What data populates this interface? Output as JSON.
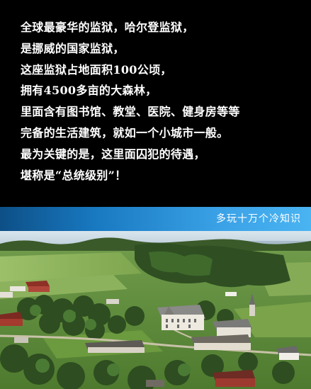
{
  "article": {
    "lines": [
      "全球最豪华的监狱，哈尔登监狱，",
      "是挪威的国家监狱，",
      "这座监狱占地面积100公顷，",
      "拥有4500多亩的大森林，",
      "里面含有图书馆、教堂、医院、健身房等等",
      "完备的生活建筑，就如一个小城市一般。",
      "最为关键的是，这里面囚犯的待遇，",
      "堪称是“总统级别”！"
    ]
  },
  "banner": {
    "text": "多玩十万个冷知识"
  },
  "colors": {
    "background": "#000000",
    "text": "#ffffff",
    "banner_start": "#0d4f86",
    "banner_end": "#4ab4f2"
  }
}
